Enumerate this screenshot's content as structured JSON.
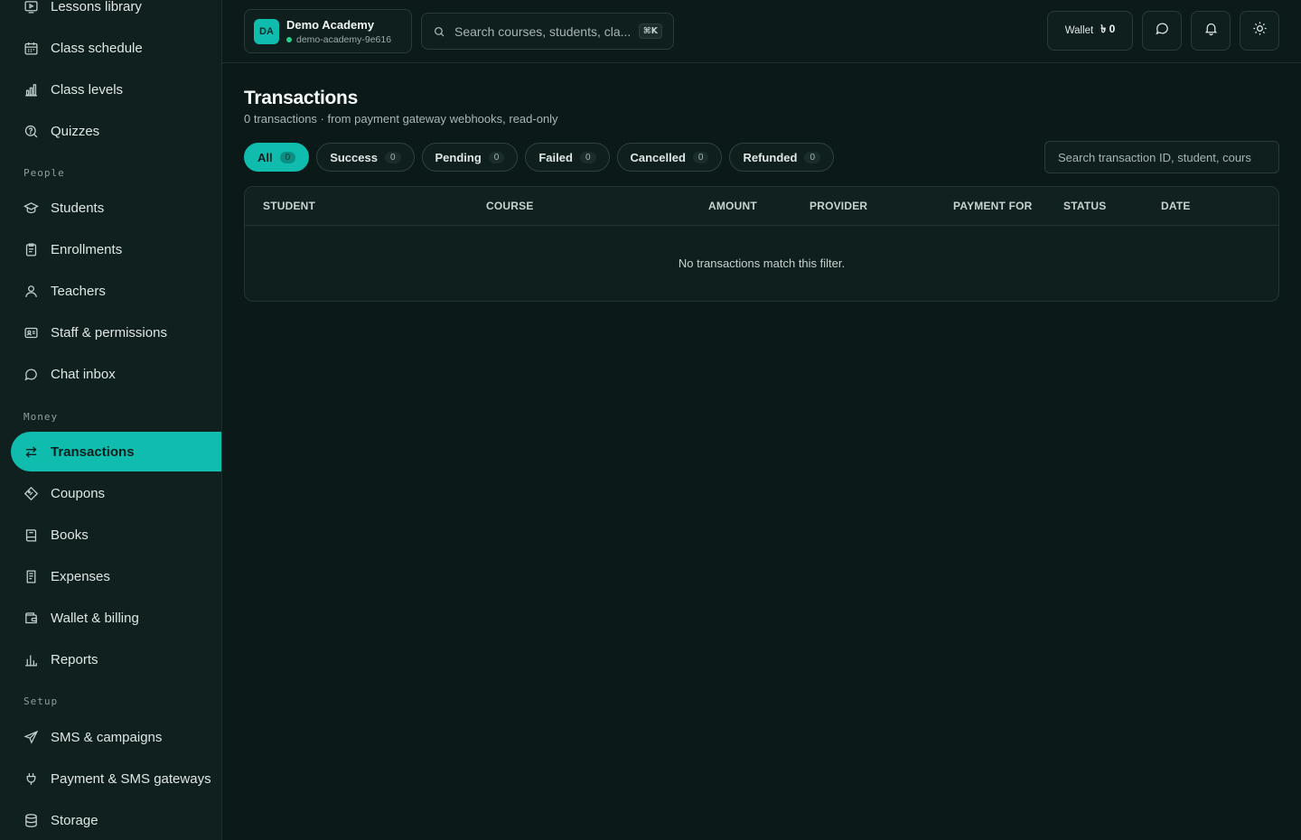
{
  "sidebar": {
    "items_top": [
      {
        "label": "Lessons library",
        "icon": "play-icon"
      },
      {
        "label": "Class schedule",
        "icon": "calendar-icon"
      },
      {
        "label": "Class levels",
        "icon": "bar-chart-icon"
      },
      {
        "label": "Quizzes",
        "icon": "quiz-search-icon"
      }
    ],
    "sections": [
      {
        "label": "People",
        "items": [
          {
            "label": "Students",
            "icon": "graduation-cap-icon"
          },
          {
            "label": "Enrollments",
            "icon": "clipboard-icon"
          },
          {
            "label": "Teachers",
            "icon": "user-icon"
          },
          {
            "label": "Staff & permissions",
            "icon": "id-card-icon"
          },
          {
            "label": "Chat inbox",
            "icon": "chat-bubble-icon"
          }
        ]
      },
      {
        "label": "Money",
        "items": [
          {
            "label": "Transactions",
            "icon": "arrows-exchange-icon",
            "active": true
          },
          {
            "label": "Coupons",
            "icon": "tag-icon"
          },
          {
            "label": "Books",
            "icon": "book-icon"
          },
          {
            "label": "Expenses",
            "icon": "receipt-icon"
          },
          {
            "label": "Wallet & billing",
            "icon": "wallet-icon"
          },
          {
            "label": "Reports",
            "icon": "reports-chart-icon"
          }
        ]
      },
      {
        "label": "Setup",
        "items": [
          {
            "label": "SMS & campaigns",
            "icon": "send-icon"
          },
          {
            "label": "Payment & SMS gateways",
            "icon": "plug-icon"
          },
          {
            "label": "Storage",
            "icon": "database-icon"
          }
        ]
      }
    ]
  },
  "header": {
    "org": {
      "initials": "DA",
      "name": "Demo Academy",
      "slug": "demo-academy-9e616"
    },
    "search": {
      "placeholder": "Search courses, students, cla...",
      "shortcut": "⌘K"
    },
    "wallet": {
      "label": "Wallet",
      "currency_symbol": "৳",
      "amount": "0"
    }
  },
  "page": {
    "title": "Transactions",
    "subtitle": "0 transactions · from payment gateway webhooks, read-only",
    "filters": [
      {
        "label": "All",
        "count": "0",
        "active": true
      },
      {
        "label": "Success",
        "count": "0"
      },
      {
        "label": "Pending",
        "count": "0"
      },
      {
        "label": "Failed",
        "count": "0"
      },
      {
        "label": "Cancelled",
        "count": "0"
      },
      {
        "label": "Refunded",
        "count": "0"
      }
    ],
    "search_placeholder": "Search transaction ID, student, cours",
    "table": {
      "columns": [
        "STUDENT",
        "COURSE",
        "AMOUNT",
        "PROVIDER",
        "PAYMENT FOR",
        "STATUS",
        "DATE"
      ],
      "empty_message": "No transactions match this filter."
    }
  },
  "colors": {
    "accent": "#0fbcae",
    "background": "#0b1a19",
    "sidebar": "#10201f",
    "online_dot": "#23d18b"
  }
}
